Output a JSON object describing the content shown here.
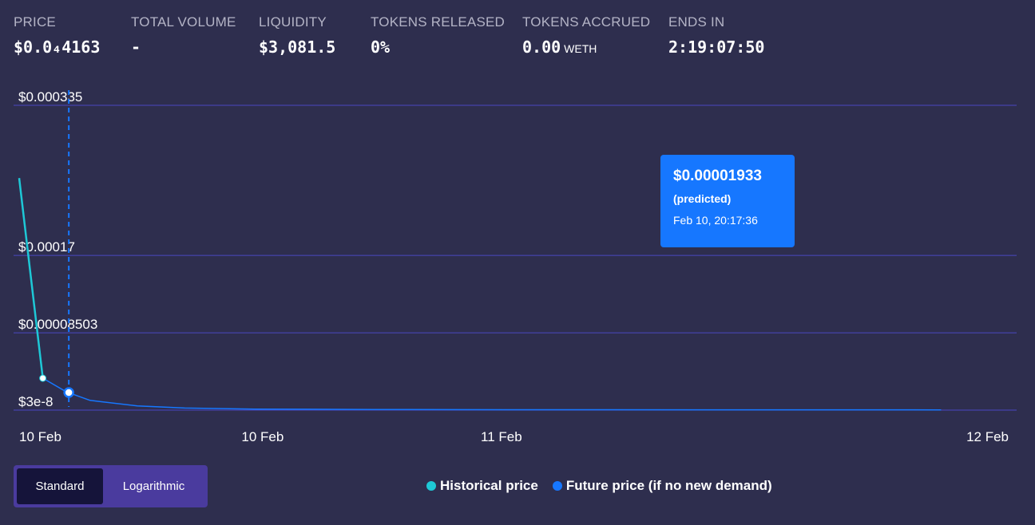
{
  "stats": [
    {
      "label": "PRICE",
      "value": "$0.0₄4163",
      "unit": ""
    },
    {
      "label": "TOTAL VOLUME",
      "value": "-",
      "unit": ""
    },
    {
      "label": "LIQUIDITY",
      "value": "$3,081.5",
      "unit": ""
    },
    {
      "label": "TOKENS RELEASED",
      "value": "0%",
      "unit": ""
    },
    {
      "label": "TOKENS ACCRUED",
      "value": "0.00",
      "unit": "WETH"
    },
    {
      "label": "ENDS IN",
      "value": "2:19:07:50",
      "unit": ""
    }
  ],
  "tooltip": {
    "price": "$0.00001933",
    "note": "(predicted)",
    "time": "Feb 10, 20:17:36"
  },
  "toggle": {
    "standard_label": "Standard",
    "logarithmic_label": "Logarithmic",
    "active": "standard"
  },
  "legend": {
    "historical_label": "Historical price",
    "future_label": "Future price (if no new demand)"
  },
  "colors": {
    "background": "#2e2e4e",
    "historical": "#1ec8d6",
    "future": "#1677ff",
    "gridline": "#4b47c2",
    "tooltip": "#1677ff",
    "toggle_bg": "#4a3b9e",
    "toggle_active": "#15143a"
  },
  "chart_data": {
    "type": "line",
    "y_ticks": [
      "$0.000335",
      "$0.00017",
      "$0.00008503",
      "$3e-8"
    ],
    "x_ticks": [
      "10 Feb",
      "10 Feb",
      "11 Feb",
      "12 Feb"
    ],
    "ylim": [
      3e-08,
      0.000335
    ],
    "y_scale": "linear",
    "grid": true,
    "series": [
      {
        "name": "Historical price",
        "points": [
          [
            0.0,
            0.000255
          ],
          [
            0.1,
            3.51e-05
          ]
        ]
      },
      {
        "name": "Future price (if no new demand)",
        "points": [
          [
            0.1,
            3.51e-05
          ],
          [
            0.2,
            2e-05
          ],
          [
            0.3,
            1.07e-05
          ],
          [
            0.5,
            4.7e-06
          ],
          [
            0.7,
            2.3e-06
          ],
          [
            1.0,
            1.2e-06
          ],
          [
            1.5,
            7e-07
          ],
          [
            2.2,
            5e-07
          ],
          [
            3.0,
            4e-07
          ],
          [
            3.9,
            3e-07
          ]
        ]
      }
    ],
    "hover_point": {
      "x": 0.21,
      "y": 1.933e-05
    }
  }
}
